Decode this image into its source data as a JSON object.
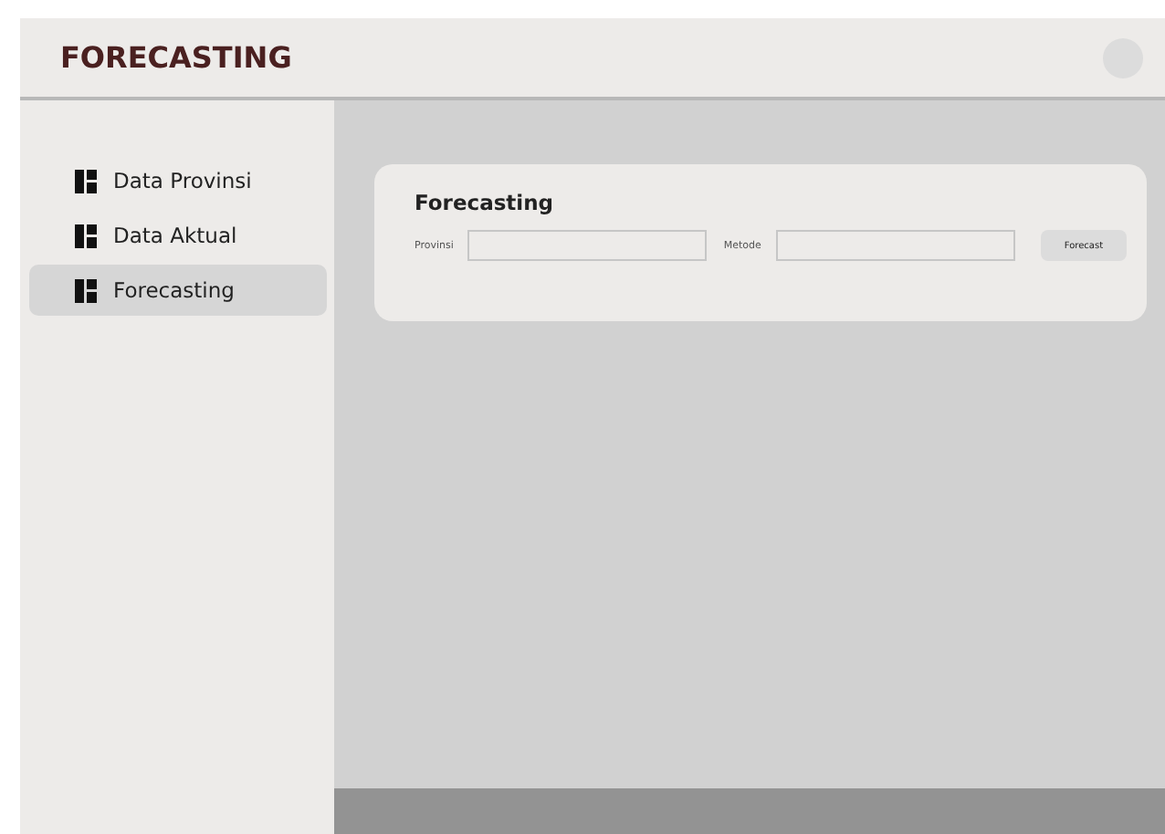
{
  "header": {
    "title": "FORECASTING"
  },
  "sidebar": {
    "items": [
      {
        "label": "Data Provinsi",
        "selected": false
      },
      {
        "label": "Data Aktual",
        "selected": false
      },
      {
        "label": "Forecasting",
        "selected": true
      }
    ]
  },
  "card": {
    "title": "Forecasting",
    "fields": [
      {
        "label": "Provinsi"
      },
      {
        "label": "Metode"
      }
    ],
    "button": "Forecast"
  }
}
